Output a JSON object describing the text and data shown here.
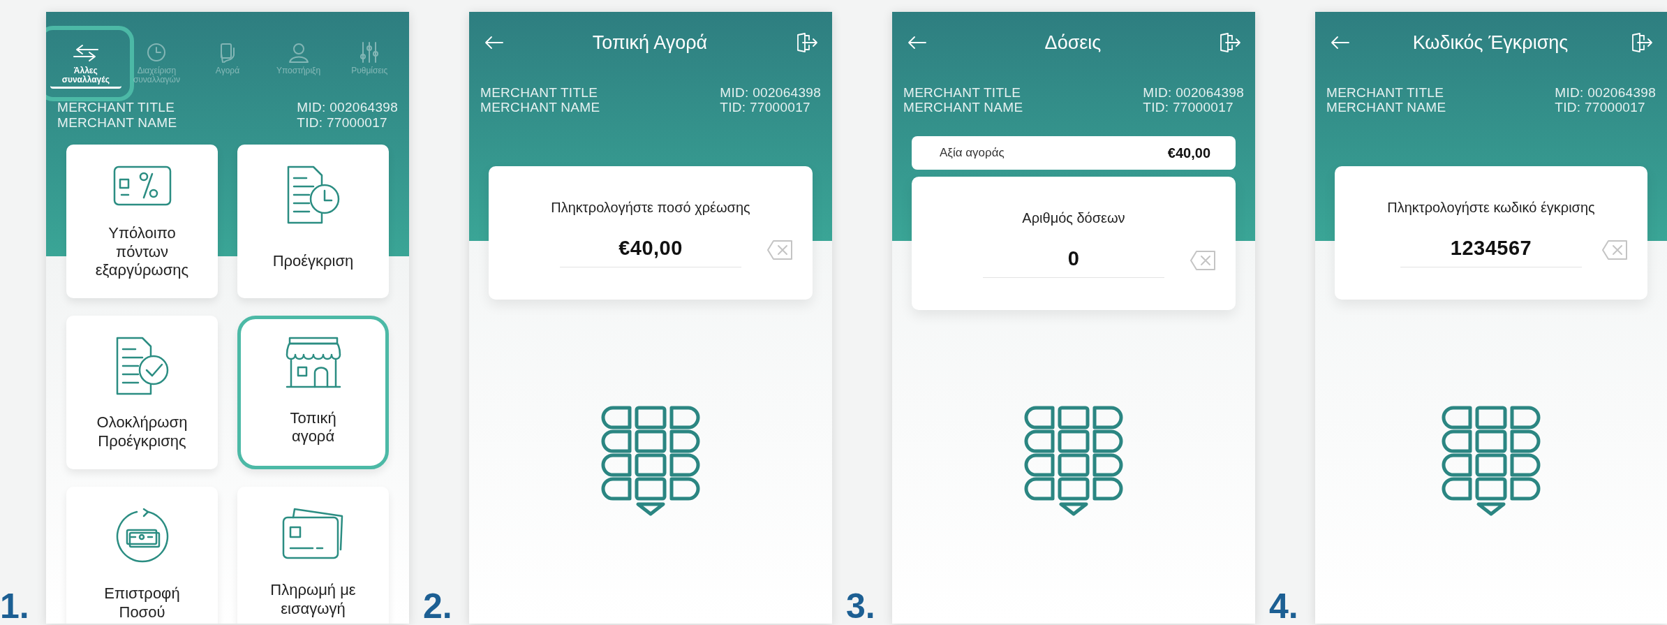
{
  "steps": [
    {
      "number": "1.",
      "screen": {
        "kind": "menu",
        "tabs": [
          {
            "label": "Άλλες\nσυναλλαγές",
            "selected": true,
            "highlighted": true
          },
          {
            "label": "Διαχείριση\nσυναλλαγών",
            "selected": false,
            "highlighted": false
          },
          {
            "label": "Αγορά",
            "selected": false,
            "highlighted": false
          },
          {
            "label": "Υποστήριξη",
            "selected": false,
            "highlighted": false
          },
          {
            "label": "Ρυθμίσεις",
            "selected": false,
            "highlighted": false
          }
        ],
        "merchant": {
          "title": "MERCHANT TITLE",
          "name": "MERCHANT NAME",
          "mid": "MID: 002064398",
          "tid": "TID: 77000017"
        },
        "tiles": [
          {
            "label": "Υπόλοιπο\nπόντων\nεξαργύρωσης",
            "highlighted": false
          },
          {
            "label": "Προέγκριση",
            "highlighted": false
          },
          {
            "label": "Ολοκλήρωση\nΠροέγκρισης",
            "highlighted": false
          },
          {
            "label": "Τοπική\nαγορά",
            "highlighted": true
          },
          {
            "label": "Επιστροφή\nΠοσού",
            "highlighted": false
          },
          {
            "label": "Πληρωμή με\nεισαγωγή",
            "highlighted": false
          }
        ]
      }
    },
    {
      "number": "2.",
      "screen": {
        "kind": "entry",
        "title": "Τοπική Αγορά",
        "merchant": {
          "title": "MERCHANT TITLE",
          "name": "MERCHANT NAME",
          "mid": "MID: 002064398",
          "tid": "TID: 77000017"
        },
        "prompt": "Πληκτρολογήστε ποσό χρέωσης",
        "value": "€40,00"
      }
    },
    {
      "number": "3.",
      "screen": {
        "kind": "entry",
        "title": "Δόσεις",
        "merchant": {
          "title": "MERCHANT TITLE",
          "name": "MERCHANT NAME",
          "mid": "MID: 002064398",
          "tid": "TID: 77000017"
        },
        "summary": {
          "label": "Αξία αγοράς",
          "value": "€40,00"
        },
        "prompt": "Αριθμός δόσεων",
        "value": "0"
      }
    },
    {
      "number": "4.",
      "screen": {
        "kind": "entry",
        "title": "Κωδικός Έγκρισης",
        "merchant": {
          "title": "MERCHANT TITLE",
          "name": "MERCHANT NAME",
          "mid": "MID: 002064398",
          "tid": "TID: 77000017"
        },
        "prompt": "Πληκτρολογήστε κωδικό έγκρισης",
        "value": "1234567"
      }
    }
  ]
}
